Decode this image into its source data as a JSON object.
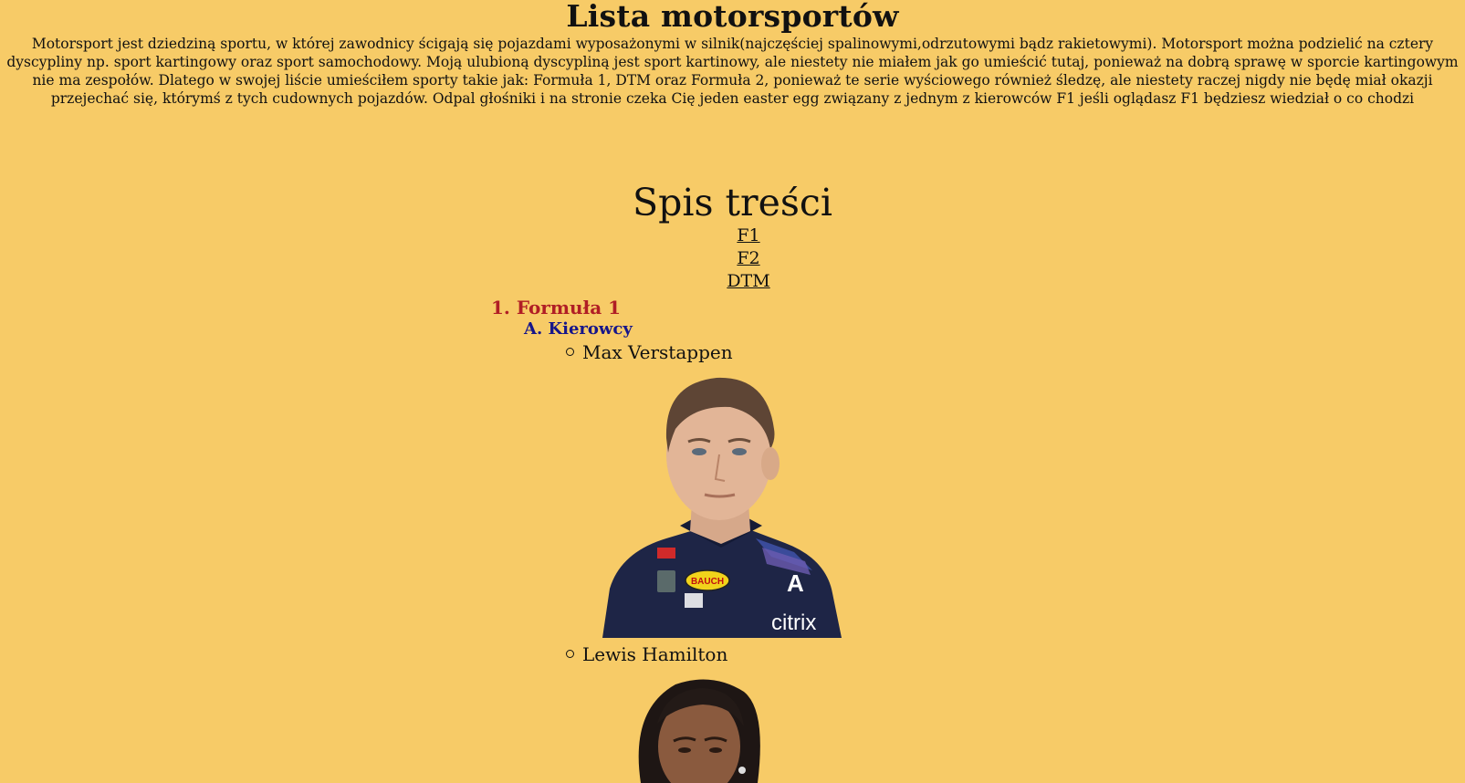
{
  "page": {
    "title": "Lista motorsportów",
    "intro": "Motorsport jest dziedziną sportu, w której zawodnicy ścigają się pojazdami wyposażonymi w silnik(najczęściej spalinowymi,odrzutowymi bądz rakietowymi). Motorsport można podzielić na cztery dyscypliny np. sport kartingowy oraz sport samochodowy. Moją ulubioną dyscypliną jest sport kartinowy, ale niestety nie miałem jak go umieścić tutaj, ponieważ na dobrą sprawę w sporcie kartingowym nie ma zespołów. Dlatego w swojej liście umieściłem sporty takie jak: Formuła 1, DTM oraz Formuła 2, ponieważ te serie wyściowego również śledzę, ale niestety raczej nigdy nie będę miał okazji przejechać się, którymś z tych cudownych pojazdów. Odpal głośniki i na stronie czeka Cię jeden easter egg związany z jednym z kierowców F1 jeśli oglądasz F1 będziesz wiedział o co chodzi"
  },
  "toc": {
    "title": "Spis treści",
    "links": [
      {
        "label": "F1"
      },
      {
        "label": "F2"
      },
      {
        "label": "DTM"
      }
    ]
  },
  "section": {
    "heading": "1. Formuła 1",
    "subheading": "A. Kierowcy",
    "drivers": [
      {
        "name": "Max Verstappen"
      },
      {
        "name": "Lewis Hamilton"
      }
    ]
  },
  "colors": {
    "background": "#f7cb67",
    "section_heading": "#b01e25",
    "subheading": "#16168a",
    "text": "#111111"
  }
}
